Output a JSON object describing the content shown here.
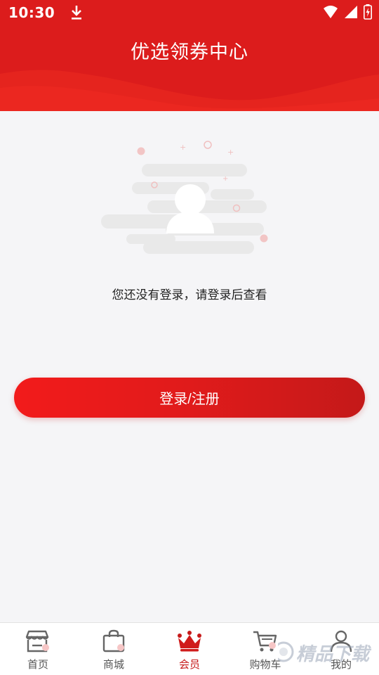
{
  "status_bar": {
    "time": "10:30"
  },
  "header": {
    "title": "优选领券中心"
  },
  "empty_state": {
    "message": "您还没有登录，请登录后查看"
  },
  "login_button": {
    "label": "登录/注册"
  },
  "tabbar": {
    "items": [
      {
        "label": "首页",
        "icon": "store-icon",
        "active": false
      },
      {
        "label": "商城",
        "icon": "shopping-bag-icon",
        "active": false
      },
      {
        "label": "会员",
        "icon": "crown-icon",
        "active": true
      },
      {
        "label": "购物车",
        "icon": "cart-icon",
        "active": false
      },
      {
        "label": "我的",
        "icon": "user-icon",
        "active": false
      }
    ]
  },
  "watermark": {
    "text": "精品下载"
  },
  "colors": {
    "brand_red": "#dc1c1c",
    "active_tab": "#c61a1a"
  }
}
